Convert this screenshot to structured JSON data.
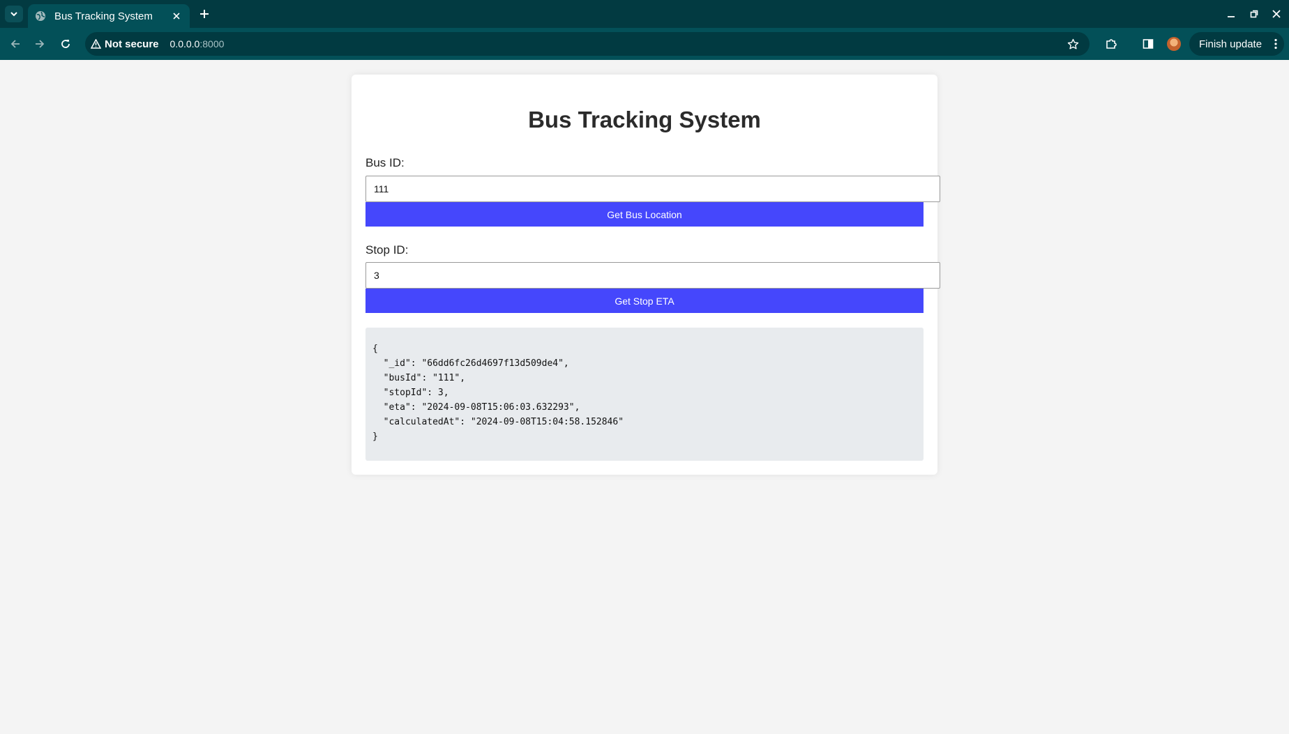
{
  "browser": {
    "tab_title": "Bus Tracking System",
    "security_label": "Not secure",
    "url_host": "0.0.0.0",
    "url_port": ":8000",
    "finish_update_label": "Finish update"
  },
  "page": {
    "title": "Bus Tracking System",
    "bus": {
      "label": "Bus ID:",
      "value": "111",
      "button_label": "Get Bus Location"
    },
    "stop": {
      "label": "Stop ID:",
      "value": "3",
      "button_label": "Get Stop ETA"
    },
    "result_text": "{\n  \"_id\": \"66dd6fc26d4697f13d509de4\",\n  \"busId\": \"111\",\n  \"stopId\": 3,\n  \"eta\": \"2024-09-08T15:06:03.632293\",\n  \"calculatedAt\": \"2024-09-08T15:04:58.152846\"\n}"
  },
  "colors": {
    "chrome_dark": "#023a41",
    "chrome_toolbar": "#035058",
    "button_bg": "#4547fc",
    "result_bg": "#e8ebee",
    "page_bg": "#f4f4f4"
  },
  "icons": {
    "tab_search": "chevron-down-icon",
    "favicon": "globe-icon",
    "close": "close-icon",
    "new_tab": "plus-icon",
    "back": "arrow-left-icon",
    "forward": "arrow-right-icon",
    "reload": "reload-icon",
    "security": "warning-triangle-icon",
    "bookmark": "star-icon",
    "extensions": "puzzle-icon",
    "side_panel": "side-panel-icon",
    "menu": "kebab-menu-icon"
  }
}
